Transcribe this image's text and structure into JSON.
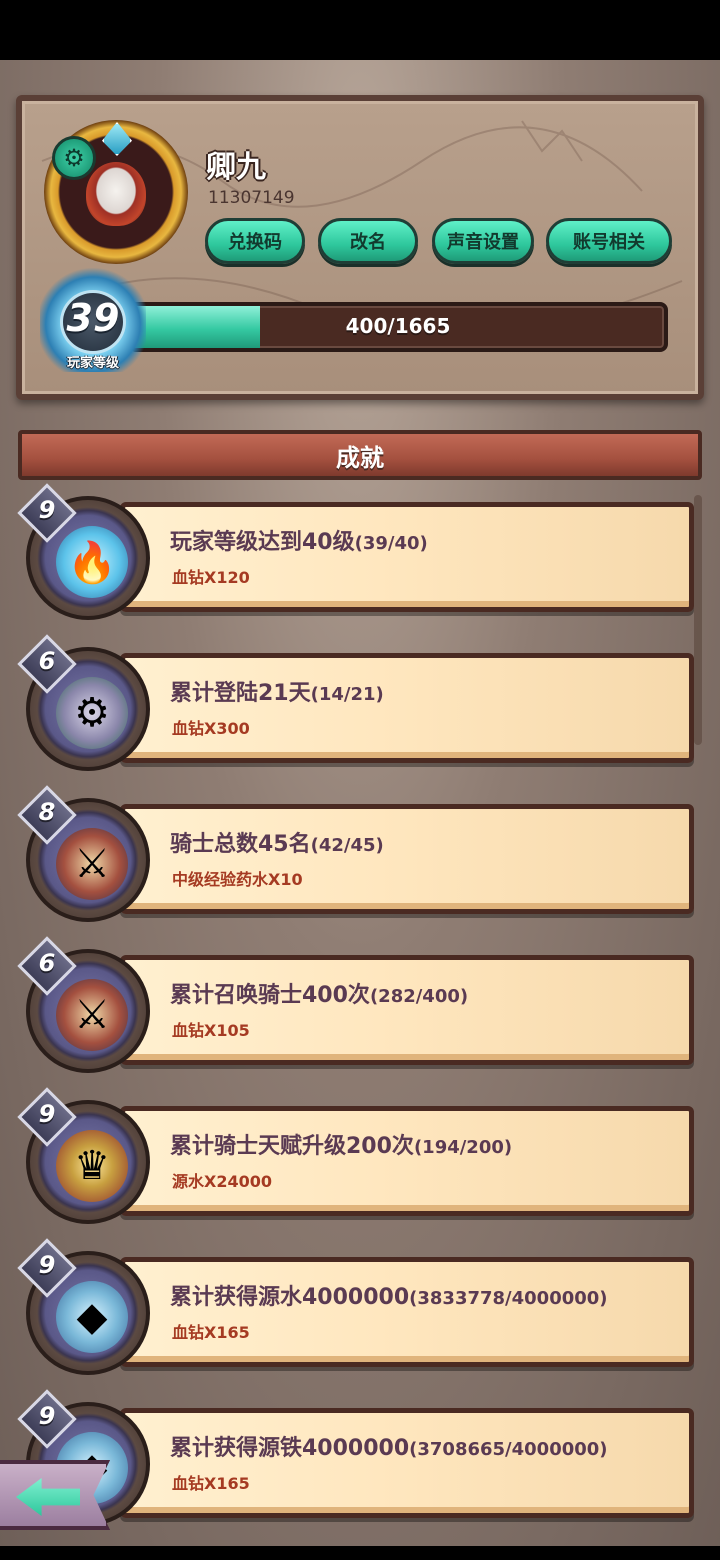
{
  "profile": {
    "name": "卿九",
    "id": "11307149",
    "buttons": {
      "redeem": "兑换码",
      "rename": "改名",
      "sound": "声音设置",
      "account": "账号相关"
    },
    "level": "39",
    "level_label": "玩家等级",
    "xp_text": "400/1665",
    "xp_progress": 0.24
  },
  "achievements_header": "成就",
  "achievements": [
    {
      "tier": "9",
      "icon": "blue-flame-icon",
      "title": "玩家等级达到40级",
      "progress": "(39/40)",
      "reward": "血钻X120"
    },
    {
      "tier": "6",
      "icon": "gear-crown-icon",
      "title": "累计登陆21天",
      "progress": "(14/21)",
      "reward": "血钻X300"
    },
    {
      "tier": "8",
      "icon": "knights-icon",
      "title": "骑士总数45名",
      "progress": "(42/45)",
      "reward": "中级经验药水X10"
    },
    {
      "tier": "6",
      "icon": "knights-icon",
      "title": "累计召唤骑士400次",
      "progress": "(282/400)",
      "reward": "血钻X105"
    },
    {
      "tier": "9",
      "icon": "talent-knight-icon",
      "title": "累计骑士天赋升级200次",
      "progress": "(194/200)",
      "reward": "源水X24000"
    },
    {
      "tier": "9",
      "icon": "crystal-ore-icon",
      "title": "累计获得源水4000000",
      "progress": "(3833778/4000000)",
      "reward": "血钻X165"
    },
    {
      "tier": "9",
      "icon": "crystal-ore-icon",
      "title": "累计获得源铁4000000",
      "progress": "(3708665/4000000)",
      "reward": "血钻X165"
    }
  ],
  "colors": {
    "accent": "#2ec79c",
    "reward": "#a53a22",
    "title": "#5a3a52",
    "frame": "#4a2a22"
  }
}
